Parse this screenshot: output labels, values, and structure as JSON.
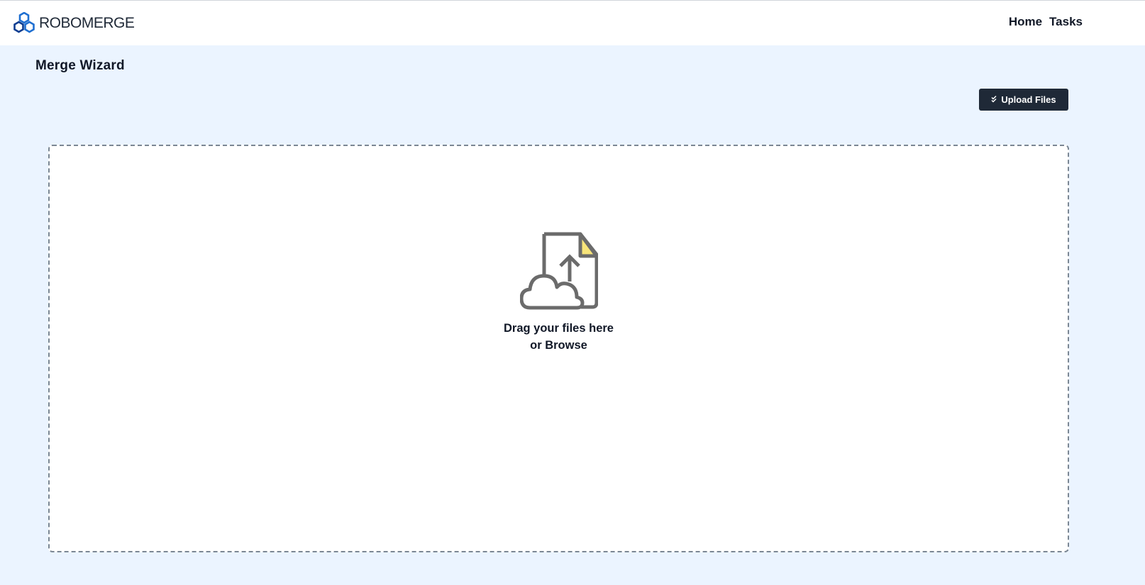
{
  "app": {
    "brand_name": "ROBOMERGE",
    "logo_icon": "hexagon-cluster-icon",
    "brand_colors": [
      "#1f6fd1",
      "#0b3d91"
    ]
  },
  "nav": {
    "items": [
      {
        "label": "Home"
      },
      {
        "label": "Tasks"
      }
    ]
  },
  "page": {
    "title": "Merge Wizard",
    "background": "#ebf4ff"
  },
  "toolbar": {
    "upload_label": "Upload Files",
    "upload_icon": "double-check-icon",
    "upload_bg": "#1f2937"
  },
  "dropzone": {
    "icon": "cloud-upload-document-icon",
    "line1": "Drag your files here",
    "line2": "or Browse",
    "accent": "#f8e57a"
  }
}
